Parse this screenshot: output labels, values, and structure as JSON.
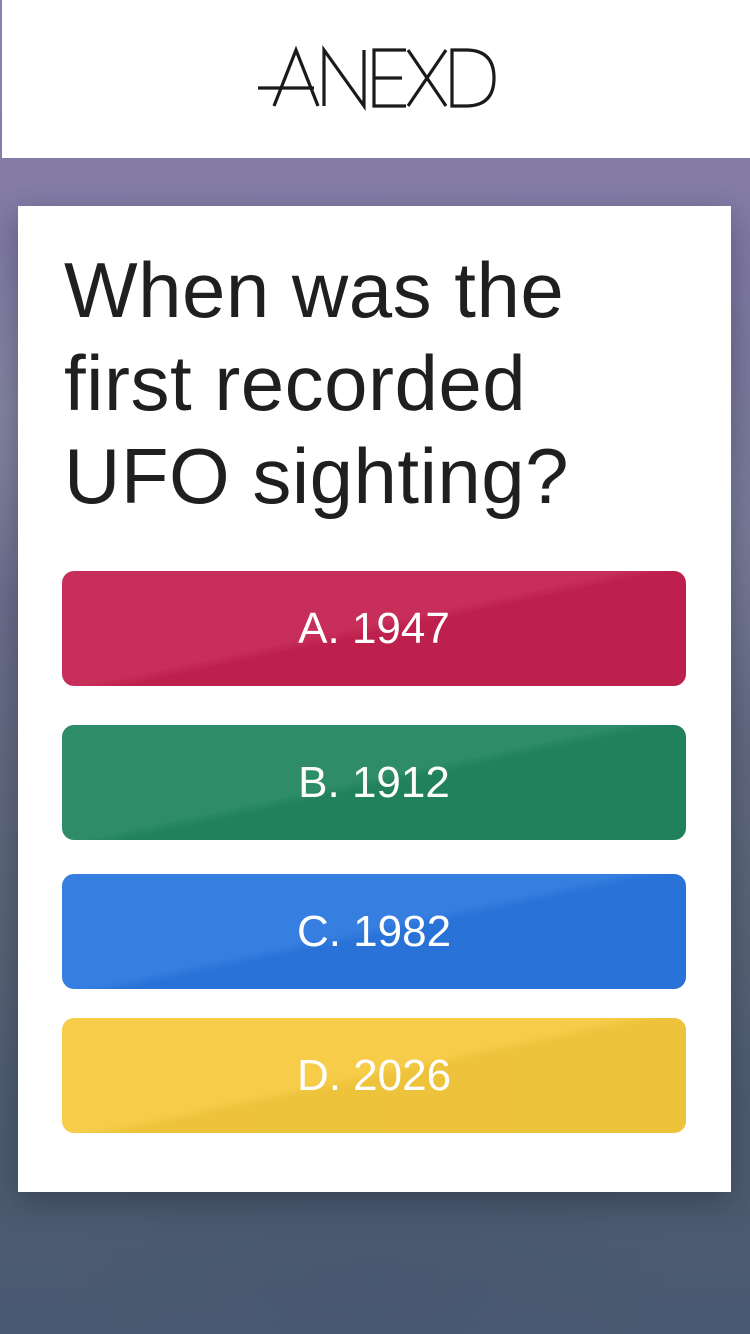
{
  "app": {
    "brand": "ANEXD"
  },
  "quiz": {
    "question": "When was the first recorded UFO sighting?",
    "answers": [
      {
        "label": "A. 1947",
        "color": "#c42150"
      },
      {
        "label": "B. 1912",
        "color": "#21855f"
      },
      {
        "label": "C. 1982",
        "color": "#2a76de"
      },
      {
        "label": "D. 2026",
        "color": "#f5c93d"
      }
    ]
  }
}
